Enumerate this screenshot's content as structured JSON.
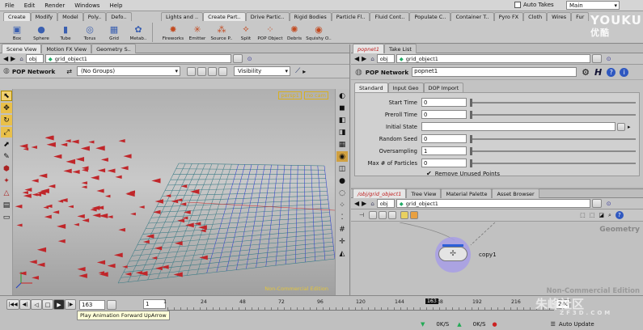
{
  "menu": [
    "File",
    "Edit",
    "Render",
    "Windows",
    "Help"
  ],
  "take": {
    "label": "Auto Takes",
    "checked": false
  },
  "desktop": "Main",
  "shelf_left": {
    "tabs": [
      "Create",
      "Modify",
      "Model",
      "Poly..",
      "Defo.."
    ],
    "tools": [
      {
        "label": "Box",
        "icon": "box-icon",
        "glyph": "▣"
      },
      {
        "label": "Sphere",
        "icon": "sphere-icon",
        "glyph": "●"
      },
      {
        "label": "Tube",
        "icon": "tube-icon",
        "glyph": "▮"
      },
      {
        "label": "Torus",
        "icon": "torus-icon",
        "glyph": "◎"
      },
      {
        "label": "Grid",
        "icon": "grid-icon",
        "glyph": "▦"
      },
      {
        "label": "Metab..",
        "icon": "metaball-icon",
        "glyph": "✿"
      }
    ]
  },
  "shelf_right": {
    "tabs": [
      "Lights and ..",
      "Create Part..",
      "Drive Partic..",
      "Rigid Bodies",
      "Particle Fl..",
      "Fluid Cont..",
      "Populate C..",
      "Container T..",
      "Pyro FX",
      "Cloth",
      "Wires",
      "Fur"
    ],
    "tools": [
      {
        "label": "Fireworks",
        "icon": "fireworks-icon",
        "glyph": "✸"
      },
      {
        "label": "Emitter",
        "icon": "emitter-icon",
        "glyph": "✳"
      },
      {
        "label": "Source P..",
        "icon": "source-particle-icon",
        "glyph": "⁂"
      },
      {
        "label": "Split",
        "icon": "split-icon",
        "glyph": "⟡"
      },
      {
        "label": "POP Object",
        "icon": "pop-object-icon",
        "glyph": "⁘"
      },
      {
        "label": "Debris",
        "icon": "debris-icon",
        "glyph": "✺"
      },
      {
        "label": "Squishy O..",
        "icon": "squishy-icon",
        "glyph": "◉"
      }
    ]
  },
  "watermark": {
    "top": "YOUKU",
    "sub": "优酷",
    "bottom_cn": "朱峰社区",
    "bottom_url": "ZF3D.COM"
  },
  "scene": {
    "tabs": [
      "Scene View",
      "Motion FX View",
      "Geometry S.."
    ],
    "path": [
      "obj",
      "grid_object1"
    ],
    "network_label": "POP Network",
    "group": "(No Groups)",
    "visibility": "Visibility",
    "camera": {
      "persp": "persp1",
      "cam": "no cam"
    },
    "noncommercial": "Non-Commercial Edition"
  },
  "params": {
    "tabs": [
      "popnet1",
      "Take List"
    ],
    "path": [
      "obj",
      "grid_object1"
    ],
    "title": "POP Network",
    "name": "popnet1",
    "subtabs": [
      "Standard",
      "Input Geo",
      "DOP Import"
    ],
    "rows": [
      {
        "label": "Start Time",
        "value": "0"
      },
      {
        "label": "Preroll Time",
        "value": "0"
      },
      {
        "label": "Initial State",
        "value": ""
      },
      {
        "label": "Random Seed",
        "value": "0"
      },
      {
        "label": "Oversampling",
        "value": "1"
      },
      {
        "label": "Max # of Particles",
        "value": "0"
      }
    ],
    "remove_unused": "Remove Unused Points"
  },
  "network": {
    "tabs": [
      "/obj/grid_object1",
      "Tree View",
      "Material Palette",
      "Asset Browser"
    ],
    "path": [
      "obj",
      "grid_object1"
    ],
    "context": "Geometry",
    "node": "copy1",
    "noncommercial": "Non-Commercial Edition"
  },
  "timeline": {
    "frame": "163",
    "range_start": "1",
    "end": "240",
    "ticks": [
      "1",
      "24",
      "48",
      "72",
      "96",
      "120",
      "144",
      "163",
      "168",
      "192",
      "216"
    ],
    "tooltip": "Play Animation Forward  UpArrow"
  },
  "status": {
    "cache1": "0K/S",
    "cache2": "0K/S",
    "auto_update": "Auto Update"
  },
  "colors": {
    "accent": "#3a6fd0",
    "particle": "#c0262a",
    "grid_blue": "#2d3fd0",
    "grid_teal": "#3c7c86",
    "node_ring": "#8a7cd8"
  }
}
